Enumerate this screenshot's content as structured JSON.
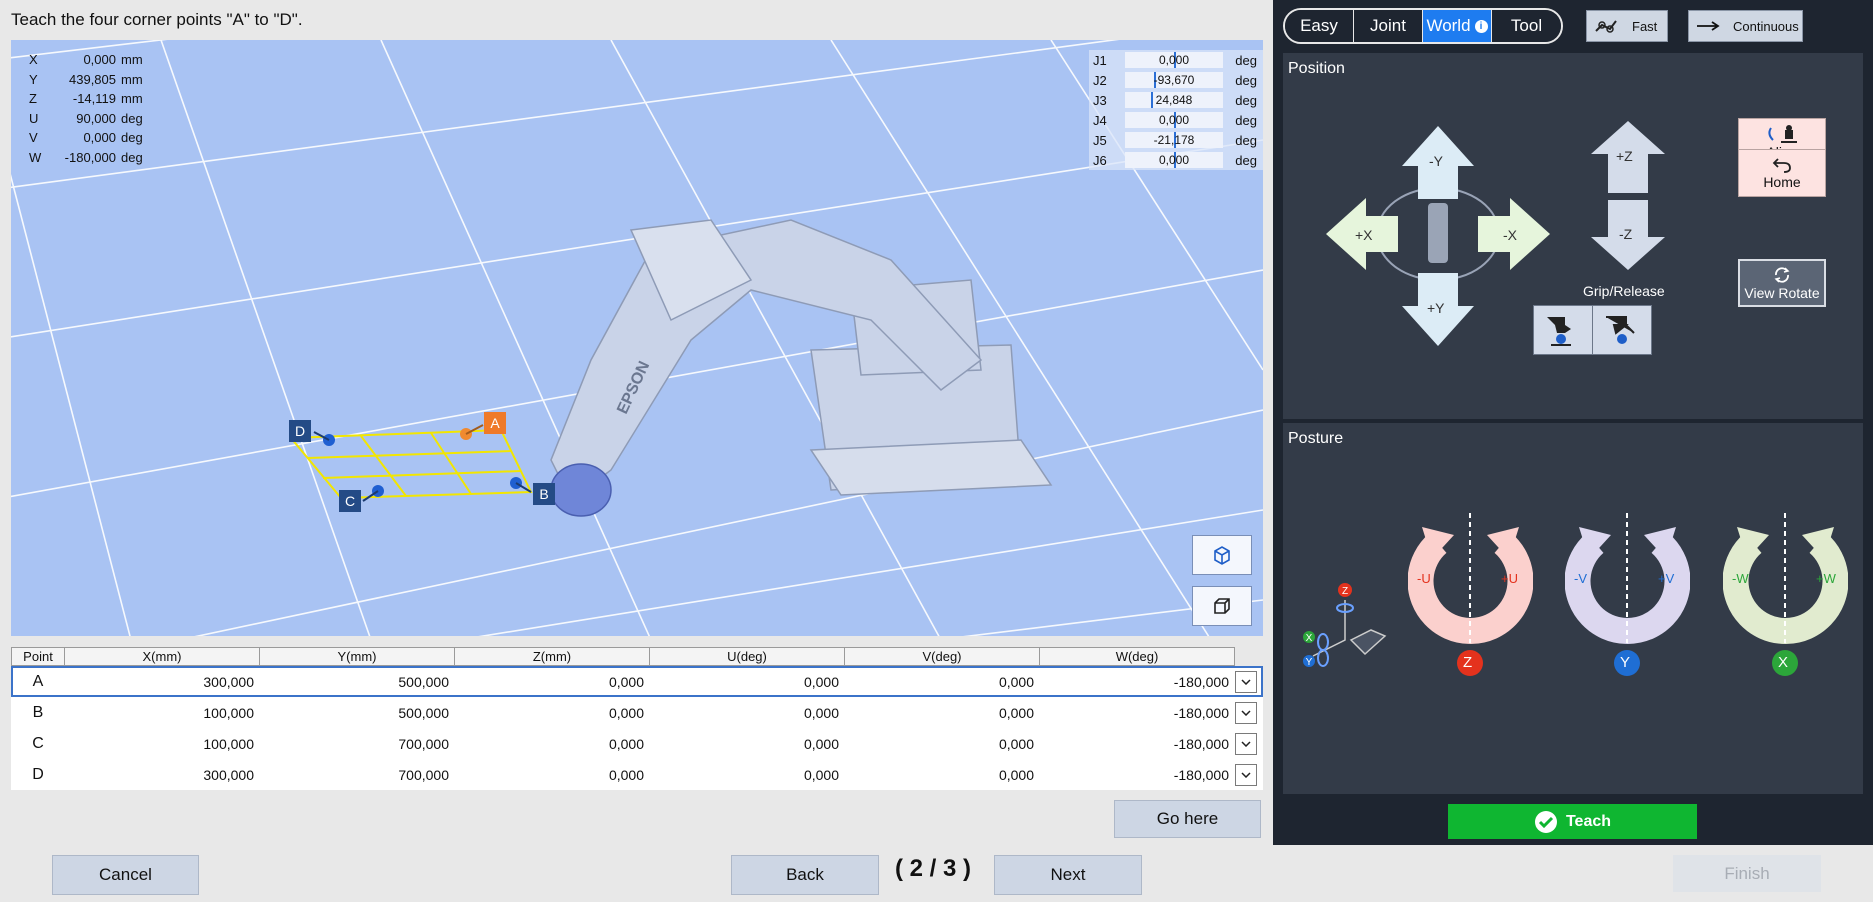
{
  "instruction": "Teach the four corner points \"A\" to \"D\".",
  "world_coords": [
    {
      "axis": "X",
      "value": "0,000",
      "unit": "mm"
    },
    {
      "axis": "Y",
      "value": "439,805",
      "unit": "mm"
    },
    {
      "axis": "Z",
      "value": "-14,119",
      "unit": "mm"
    },
    {
      "axis": "U",
      "value": "90,000",
      "unit": "deg"
    },
    {
      "axis": "V",
      "value": "0,000",
      "unit": "deg"
    },
    {
      "axis": "W",
      "value": "-180,000",
      "unit": "deg"
    }
  ],
  "joints": [
    {
      "name": "J1",
      "value": "0,000",
      "unit": "deg",
      "level": 0.5
    },
    {
      "name": "J2",
      "value": "-93,670",
      "unit": "deg",
      "level": 0.3
    },
    {
      "name": "J3",
      "value": "24,848",
      "unit": "deg",
      "level": 0.27
    },
    {
      "name": "J4",
      "value": "0,000",
      "unit": "deg",
      "level": 0.5
    },
    {
      "name": "J5",
      "value": "-21,178",
      "unit": "deg",
      "level": 0.5
    },
    {
      "name": "J6",
      "value": "0,000",
      "unit": "deg",
      "level": 0.5
    }
  ],
  "scene": {
    "brand": "EPSON",
    "corner_labels": [
      "A",
      "B",
      "C",
      "D"
    ]
  },
  "table": {
    "headers": [
      "Point",
      "X(mm)",
      "Y(mm)",
      "Z(mm)",
      "U(deg)",
      "V(deg)",
      "W(deg)"
    ],
    "rows": [
      [
        "A",
        "300,000",
        "500,000",
        "0,000",
        "0,000",
        "0,000",
        "-180,000"
      ],
      [
        "B",
        "100,000",
        "500,000",
        "0,000",
        "0,000",
        "0,000",
        "-180,000"
      ],
      [
        "C",
        "100,000",
        "700,000",
        "0,000",
        "0,000",
        "0,000",
        "-180,000"
      ],
      [
        "D",
        "300,000",
        "700,000",
        "0,000",
        "0,000",
        "0,000",
        "-180,000"
      ]
    ],
    "selected_row": 0
  },
  "buttons": {
    "go_here": "Go here",
    "cancel": "Cancel",
    "back": "Back",
    "next": "Next",
    "finish": "Finish",
    "teach": "Teach"
  },
  "page_indicator": "( 2 / 3 )",
  "modes": [
    "Easy",
    "Joint",
    "World",
    "Tool"
  ],
  "active_mode": "World",
  "speed": "Fast",
  "motion": "Continuous",
  "position": {
    "title": "Position",
    "labels": {
      "minus_y": "-Y",
      "plus_y": "+Y",
      "plus_x": "+X",
      "minus_x": "-X",
      "plus_z": "+Z",
      "minus_z": "-Z"
    },
    "grip_release": "Grip/Release",
    "align": "Align",
    "home": "Home",
    "view_rotate": "View Rotate"
  },
  "posture": {
    "title": "Posture",
    "rings": [
      {
        "minus": "-U",
        "plus": "+U",
        "axis": "Z",
        "color": "#fbd0cd",
        "axis_color": "#e4321d"
      },
      {
        "minus": "-V",
        "plus": "+V",
        "axis": "Y",
        "color": "#dcd7ef",
        "axis_color": "#1f6ed4"
      },
      {
        "minus": "-W",
        "plus": "+W",
        "axis": "X",
        "color": "#e1ebcf",
        "axis_color": "#2ca63a"
      }
    ]
  },
  "colors": {
    "accent": "#1e7cf0",
    "teach": "#0fb631",
    "panel": "#333b48",
    "viewport": "#a9c3f3"
  }
}
